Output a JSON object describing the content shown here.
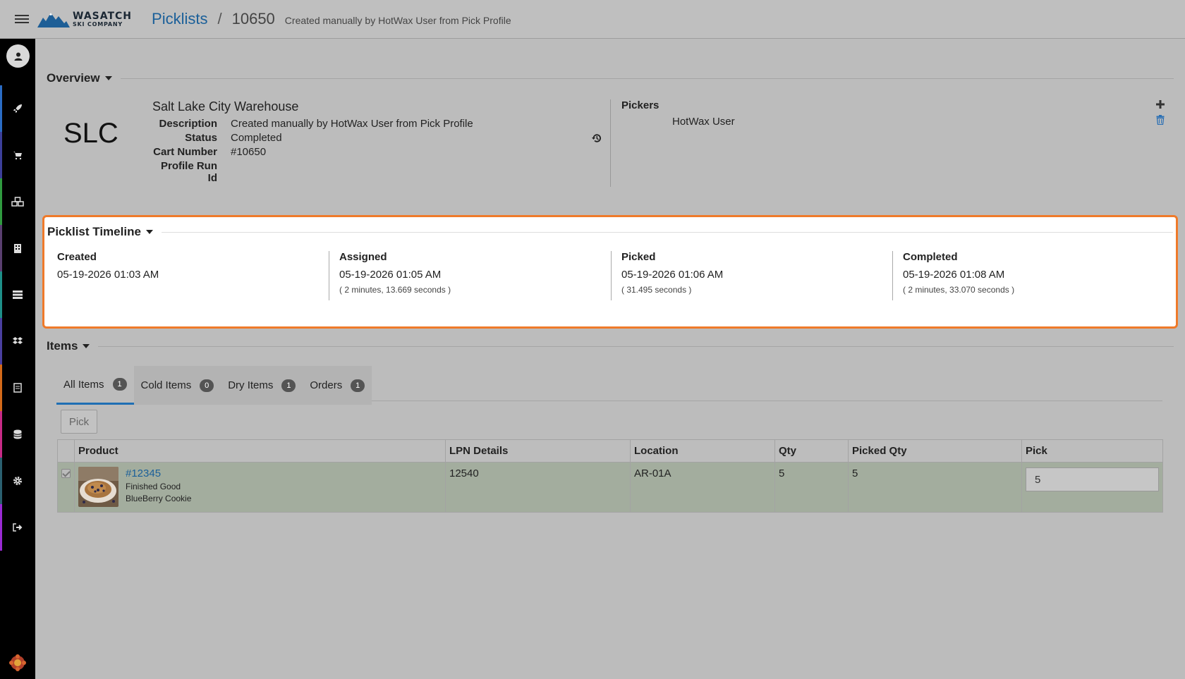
{
  "header": {
    "brand_line1": "WASATCH",
    "brand_line2": "SKI COMPANY",
    "breadcrumb_link": "Picklists",
    "breadcrumb_sep": "/",
    "picklist_id": "10650",
    "description": "Created manually by HotWax User from Pick Profile"
  },
  "overview": {
    "title": "Overview",
    "code": "SLC",
    "warehouse": "Salt Lake City Warehouse",
    "fields": [
      {
        "label": "Description",
        "value": "Created manually by HotWax User from Pick Profile"
      },
      {
        "label": "Status",
        "value": "Completed"
      },
      {
        "label": "Cart Number",
        "value": "#10650"
      },
      {
        "label": "Profile Run Id",
        "value": ""
      }
    ],
    "pickers_title": "Pickers",
    "pickers": [
      "HotWax User"
    ]
  },
  "timeline": {
    "title": "Picklist Timeline",
    "steps": [
      {
        "label": "Created",
        "datetime": "05-19-2026 01:03 AM",
        "duration": ""
      },
      {
        "label": "Assigned",
        "datetime": "05-19-2026 01:05 AM",
        "duration": "( 2 minutes, 13.669 seconds )"
      },
      {
        "label": "Picked",
        "datetime": "05-19-2026 01:06 AM",
        "duration": "( 31.495 seconds )"
      },
      {
        "label": "Completed",
        "datetime": "05-19-2026 01:08 AM",
        "duration": "( 2 minutes, 33.070 seconds )"
      }
    ]
  },
  "items": {
    "title": "Items",
    "tabs": [
      {
        "label": "All Items",
        "count": "1"
      },
      {
        "label": "Cold Items",
        "count": "0"
      },
      {
        "label": "Dry Items",
        "count": "1"
      },
      {
        "label": "Orders",
        "count": "1"
      }
    ],
    "pick_button": "Pick",
    "columns": [
      "Product",
      "LPN Details",
      "Location",
      "Qty",
      "Picked Qty",
      "Pick"
    ],
    "rows": [
      {
        "product_id": "#12345",
        "product_type": "Finished Good",
        "product_name": "BlueBerry Cookie",
        "lpn": "12540",
        "location": "AR-01A",
        "qty": "5",
        "picked_qty": "5",
        "pick_value": "5"
      }
    ]
  },
  "colors": {
    "accent": "#1a5f99",
    "timeline_border": "#ef7a2a",
    "row_bg": "#a3ad9e",
    "sidebar_stripes": [
      "#2a6cc4",
      "#3c3f9a",
      "#2f9a3f",
      "#5a3f70",
      "#1e8f88",
      "#4a3fa0",
      "#d46a1a",
      "#c72a86",
      "#2a6070",
      "#9a2ad4"
    ]
  },
  "sidebar": {
    "icons": [
      "avatar-icon",
      "rocket-icon",
      "cart-icon",
      "cubes-icon",
      "building-icon",
      "server-icon",
      "dropbox-icon",
      "receipt-icon",
      "database-icon",
      "gear-icon",
      "sign-out-icon"
    ]
  }
}
